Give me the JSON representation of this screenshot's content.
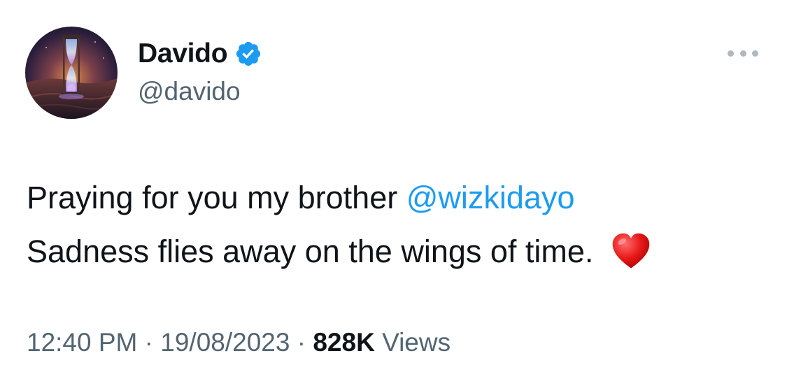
{
  "author": {
    "display_name": "Davido",
    "handle": "@davido",
    "verified": true,
    "verified_color": "#1d9bf0"
  },
  "more_button": {
    "icon": "more-horizontal-icon"
  },
  "tweet": {
    "line1_text": "Praying for you my brother ",
    "mention": "@wizkidayo",
    "line2_text": "Sadness flies away on the wings of time. ",
    "emoji": "red-heart-emoji",
    "mention_color": "#1d9bf0"
  },
  "meta": {
    "time": "12:40 PM",
    "separator1": " · ",
    "date": "19/08/2023",
    "separator2": " · ",
    "views_count": "828K",
    "views_label": " Views"
  }
}
